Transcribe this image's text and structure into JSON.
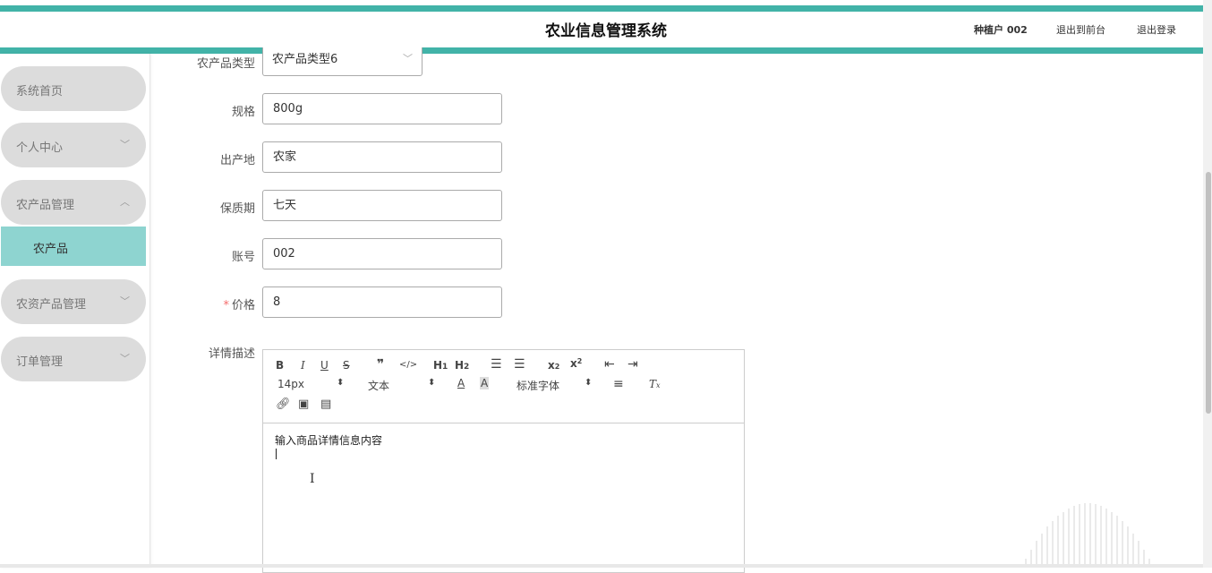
{
  "header": {
    "title": "农业信息管理系统",
    "user": "种植户 002",
    "go_front": "退出到前台",
    "logout": "退出登录"
  },
  "sidebar": {
    "items": [
      {
        "label": "系统首页"
      },
      {
        "label": "个人中心",
        "chevron": "chevron-down-icon"
      },
      {
        "label": "农产品管理",
        "chevron": "chevron-up-icon"
      },
      {
        "label": "农资产品管理",
        "chevron": "chevron-down-icon"
      },
      {
        "label": "订单管理",
        "chevron": "chevron-down-icon"
      }
    ],
    "sub_items": [
      {
        "label": "农产品"
      }
    ]
  },
  "form": {
    "type_label": "农产品类型",
    "type_value": "农产品类型6",
    "spec_label": "规格",
    "spec_value": "800g",
    "origin_label": "出产地",
    "origin_value": "农家",
    "shelf_label": "保质期",
    "shelf_value": "七天",
    "account_label": "账号",
    "account_value": "002",
    "price_required": "*",
    "price_label": "价格",
    "price_value": "8",
    "detail_label": "详情描述"
  },
  "editor": {
    "font_size": "14px",
    "text_style": "文本",
    "font_family": "标准字体",
    "content": "输入商品详情信息内容"
  },
  "colors": {
    "accent": "#42b3a8",
    "menu_bg": "#dcdcdc",
    "submenu_active": "#8ed4d0",
    "required": "#f56c6c"
  }
}
